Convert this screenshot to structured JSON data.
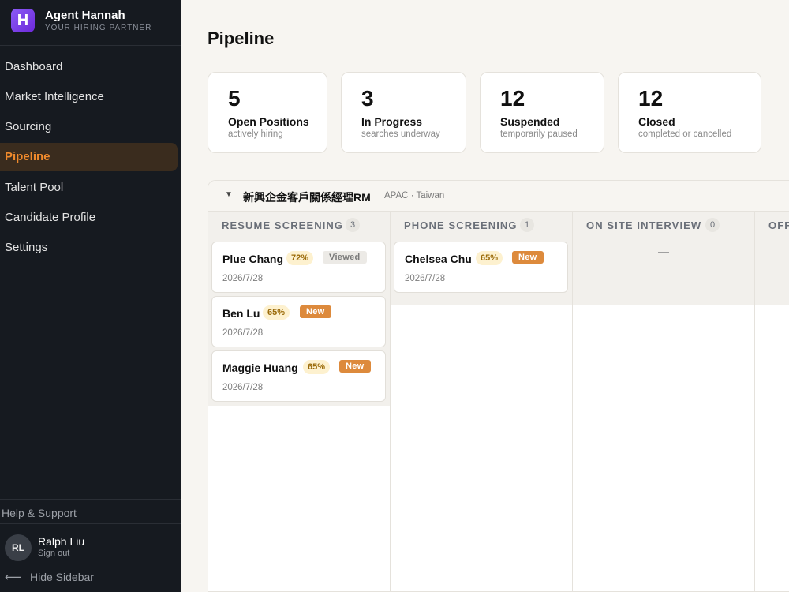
{
  "app": {
    "name": "Agent Hannah",
    "tagline": "YOUR HIRING PARTNER",
    "logo_letter": "H",
    "accent": "#f08a2c"
  },
  "sidebar": {
    "items": [
      {
        "label": "Dashboard"
      },
      {
        "label": "Market Intelligence"
      },
      {
        "label": "Sourcing"
      },
      {
        "label": "Pipeline",
        "active": true
      },
      {
        "label": "Talent Pool"
      },
      {
        "label": "Candidate Profile"
      },
      {
        "label": "Settings"
      }
    ],
    "help": "Help & Support",
    "user": {
      "initials": "RL",
      "name": "Ralph Liu",
      "signout": "Sign out"
    },
    "hide_arrow": "⟵",
    "hide_label": "Hide Sidebar"
  },
  "page": {
    "title": "Pipeline"
  },
  "stats": [
    {
      "value": "5",
      "label": "Open Positions",
      "sub": "actively hiring"
    },
    {
      "value": "3",
      "label": "In Progress",
      "sub": "searches underway"
    },
    {
      "value": "12",
      "label": "Suspended",
      "sub": "temporarily paused"
    },
    {
      "value": "12",
      "label": "Closed",
      "sub": "completed or cancelled"
    }
  ],
  "board": {
    "caret": "▼",
    "title": "新興企金客戶關係經理RM",
    "meta": "APAC · Taiwan",
    "columns": [
      {
        "title": "RESUME SCREENING",
        "count": "3",
        "cards": [
          {
            "name": "Plue Chang",
            "pct": "72%",
            "tag": "Viewed",
            "date": "2026/7/28"
          },
          {
            "name": "Ben Lu",
            "pct": "65%",
            "tag": "New",
            "date": "2026/7/28"
          },
          {
            "name": "Maggie Huang",
            "pct": "65%",
            "tag": "New",
            "date": "2026/7/28"
          }
        ]
      },
      {
        "title": "PHONE SCREENING",
        "count": "1",
        "cards": [
          {
            "name": "Chelsea Chu",
            "pct": "65%",
            "tag": "New",
            "date": "2026/7/28"
          }
        ]
      },
      {
        "title": "ON SITE INTERVIEW",
        "count": "0",
        "empty": "—"
      },
      {
        "title": "OFF"
      }
    ]
  }
}
